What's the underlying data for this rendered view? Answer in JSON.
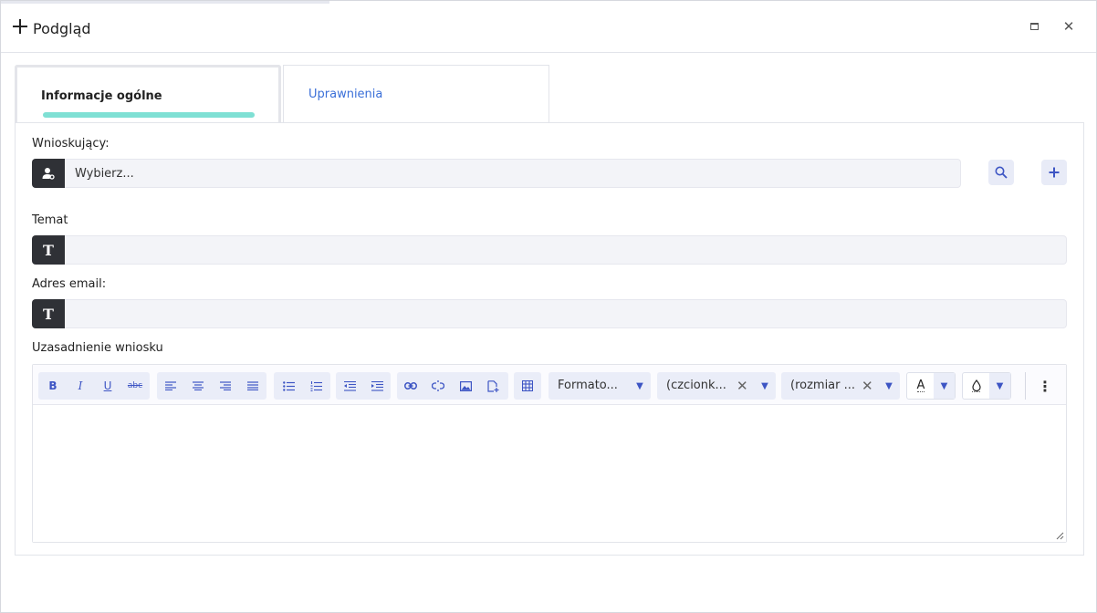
{
  "window": {
    "title": "Podgląd",
    "maximize_label": "maximize",
    "close_label": "✕"
  },
  "tabs": [
    {
      "label": "Informacje ogólne",
      "active": true
    },
    {
      "label": "Uprawnienia",
      "active": false
    }
  ],
  "fields": {
    "wnioskujacy": {
      "label": "Wnioskujący:",
      "value": "Wybierz..."
    },
    "temat": {
      "label": "Temat",
      "value": ""
    },
    "email": {
      "label": "Adres email:",
      "value": ""
    },
    "uzasadnienie": {
      "label": "Uzasadnienie wniosku",
      "value": ""
    }
  },
  "toolbar": {
    "bold": "B",
    "italic": "I",
    "underline": "U",
    "strike": "abc",
    "format_select": "Formato...",
    "font_select": "(czcionk...",
    "size_select": "(rozmiar ...",
    "font_color_glyph": "A"
  },
  "colors": {
    "accent": "#3d55c4",
    "tab_underline": "#7fe0d4",
    "link": "#3a6fd8",
    "icon_bg": "#2f3136",
    "input_bg": "#f3f4f8"
  },
  "icons": [
    "plus-icon",
    "maximize-icon",
    "close-icon",
    "user-icon",
    "search-icon",
    "add-icon",
    "text-icon"
  ]
}
